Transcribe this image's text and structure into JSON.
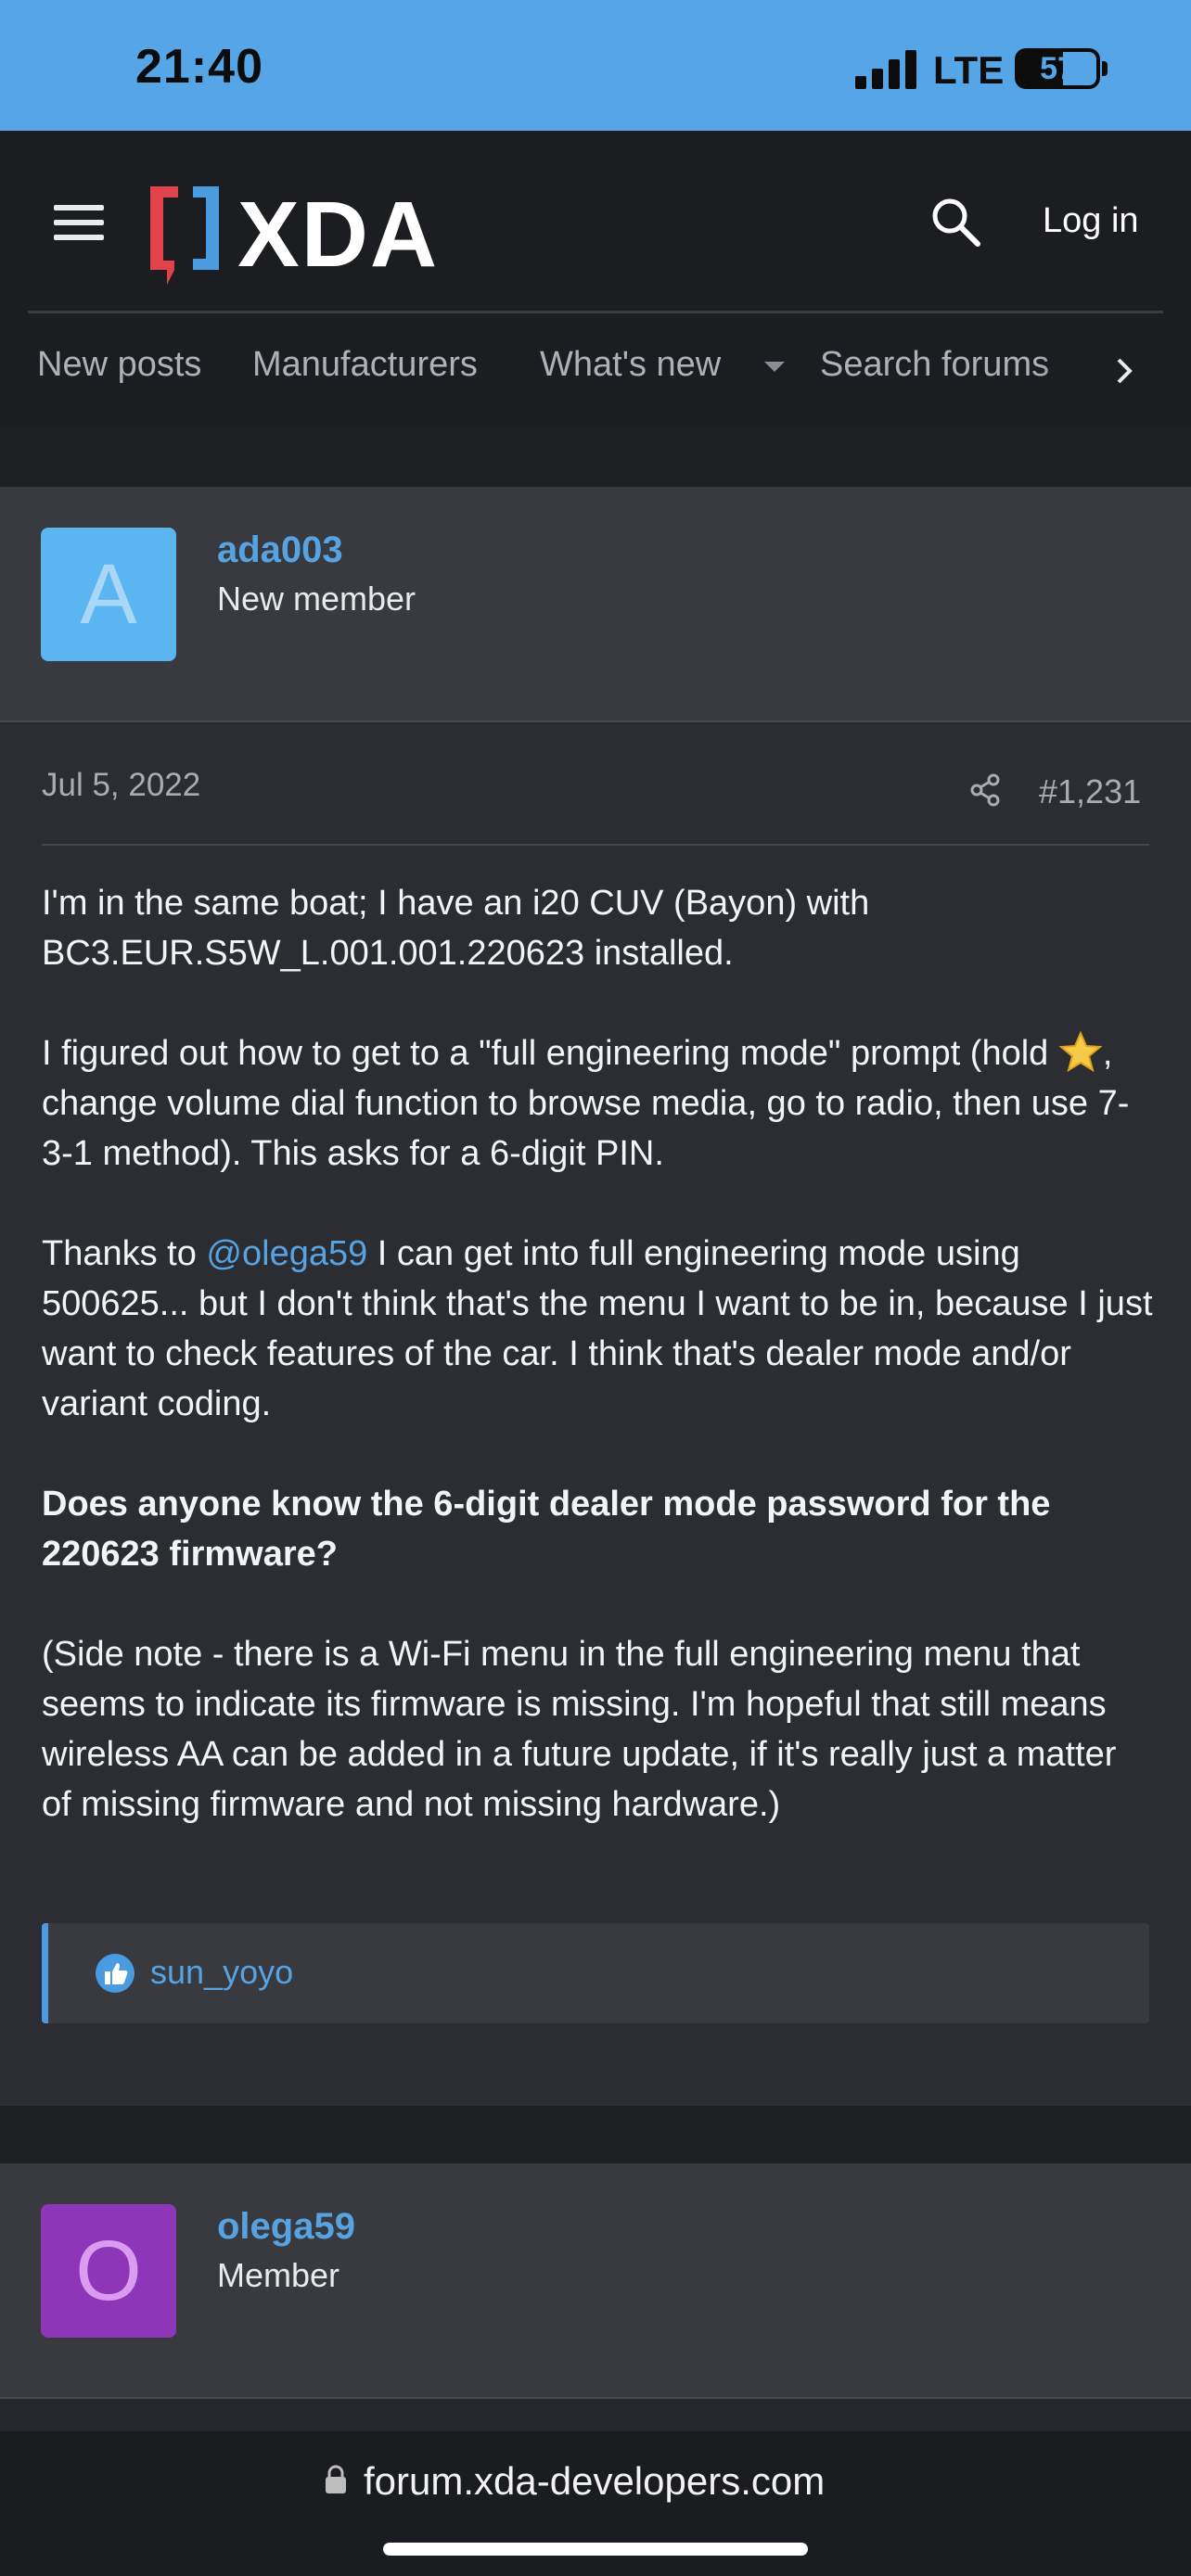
{
  "status_bar": {
    "time": "21:40",
    "network": "LTE",
    "battery": "57",
    "battery_level": 0.57
  },
  "header": {
    "logo_text": "XDA",
    "login_label": "Log in"
  },
  "nav": {
    "items": [
      "New posts",
      "Manufacturers",
      "What's new",
      "Search forums"
    ]
  },
  "post": {
    "author": {
      "avatar_letter": "A",
      "avatar_color": "#5bb5f0",
      "avatar_letter_color": "#a9d7f7",
      "username": "ada003",
      "title": "New member"
    },
    "date": "Jul 5, 2022",
    "number": "#1,231",
    "paragraphs": {
      "p1": "I'm in the same boat; I have an i20 CUV (Bayon) with BC3.EUR.S5W_L.001.001.220623 installed.",
      "p2_before": "I figured out how to get to a \"full engineering mode\" prompt (hold ",
      "p2_after": ", change volume dial function to browse media, go to radio, then use 7-3-1 method). This asks for a 6-digit PIN.",
      "p3_before": "Thanks to ",
      "p3_mention": "@olega59",
      "p3_after": " I can get into full engineering mode using 500625... but I don't think that's the menu I want to be in, because I just want to check features of the car. I think that's dealer mode and/or variant coding.",
      "p4_bold": "Does anyone know the 6-digit dealer mode password for the 220623 firmware?",
      "p5": "(Side note - there is a Wi-Fi menu in the full engineering menu that seems to indicate its firmware is missing. I'm hopeful that still means wireless AA can be added in a future update, if it's really just a matter of missing firmware and not missing hardware.)"
    },
    "reaction_user": "sun_yoyo"
  },
  "next_post": {
    "author": {
      "avatar_letter": "O",
      "avatar_color": "#8e36b8",
      "avatar_letter_color": "#d99cf2",
      "username": "olega59",
      "title": "Member"
    }
  },
  "browser": {
    "url": "forum.xda-developers.com"
  },
  "colors": {
    "accent": "#57a3e2",
    "status_bar": "#56a5e6",
    "background": "#25272c"
  }
}
